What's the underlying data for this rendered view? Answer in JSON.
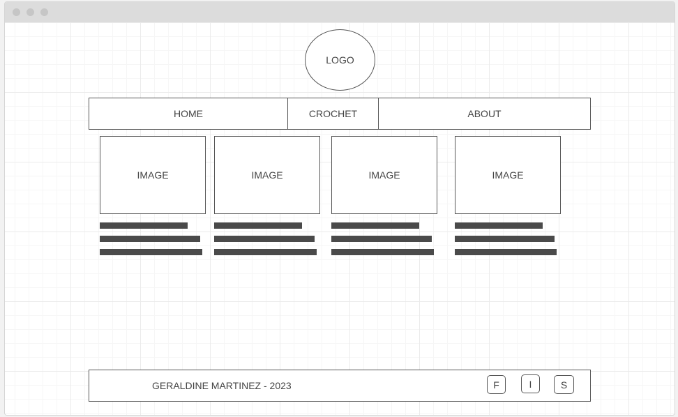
{
  "logo": {
    "label": "LOGO"
  },
  "nav": {
    "items": [
      {
        "label": "HOME"
      },
      {
        "label": "CROCHET"
      },
      {
        "label": "ABOUT"
      }
    ]
  },
  "cards": [
    {
      "image_label": "IMAGE"
    },
    {
      "image_label": "IMAGE"
    },
    {
      "image_label": "IMAGE"
    },
    {
      "image_label": "IMAGE"
    }
  ],
  "footer": {
    "text": "GERALDINE MARTINEZ - 2023",
    "social": [
      {
        "label": "F"
      },
      {
        "label": "I"
      },
      {
        "label": "S"
      }
    ]
  }
}
